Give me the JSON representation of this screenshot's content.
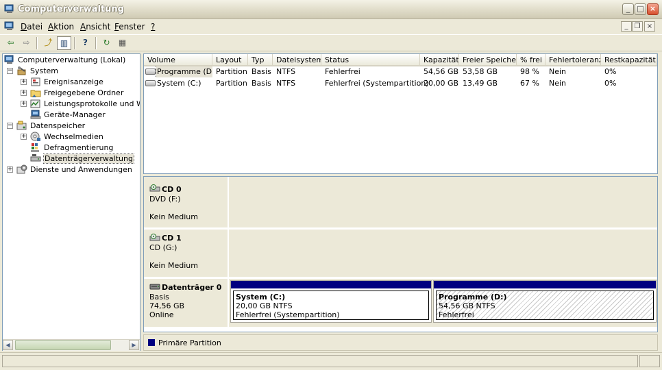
{
  "window": {
    "title": "Computerverwaltung",
    "controls": {
      "minimize": "_",
      "maximize": "□",
      "close": "×"
    }
  },
  "menu": [
    {
      "label": "Datei",
      "accel": "D",
      "rest": "atei"
    },
    {
      "label": "Aktion",
      "accel": "A",
      "rest": "ktion"
    },
    {
      "label": "Ansicht",
      "accel": "A",
      "rest": "nsicht"
    },
    {
      "label": "Fenster",
      "accel": "F",
      "rest": "enster"
    },
    {
      "label": "?",
      "accel": "?",
      "rest": ""
    }
  ],
  "mdi_controls": {
    "minimize": "_",
    "restore": "❐",
    "close": "×"
  },
  "toolbar": [
    {
      "icon": "back-arrow-icon",
      "glyph": "⇦"
    },
    {
      "icon": "forward-arrow-icon",
      "glyph": "⇨"
    },
    {
      "icon": "up-folder-icon",
      "glyph": "⤴"
    },
    {
      "icon": "show-hide-tree-icon",
      "glyph": "▥"
    },
    {
      "icon": "help-icon",
      "glyph": "?"
    },
    {
      "icon": "refresh-icon",
      "glyph": "↻"
    },
    {
      "icon": "properties-icon",
      "glyph": "▦"
    }
  ],
  "tree": {
    "root": "Computerverwaltung (Lokal)",
    "items": [
      {
        "label": "System",
        "expander": "−",
        "icon": "tools-icon"
      },
      {
        "label": "Ereignisanzeige",
        "expander": "+",
        "icon": "event-viewer-icon"
      },
      {
        "label": "Freigegebene Ordner",
        "expander": "+",
        "icon": "shared-folder-icon"
      },
      {
        "label": "Leistungsprotokolle und Warn",
        "expander": "+",
        "icon": "performance-icon"
      },
      {
        "label": "Geräte-Manager",
        "expander": "",
        "icon": "device-manager-icon"
      },
      {
        "label": "Datenspeicher",
        "expander": "−",
        "icon": "storage-icon"
      },
      {
        "label": "Wechselmedien",
        "expander": "+",
        "icon": "removable-media-icon"
      },
      {
        "label": "Defragmentierung",
        "expander": "",
        "icon": "defrag-icon"
      },
      {
        "label": "Datenträgerverwaltung",
        "expander": "",
        "icon": "disk-management-icon"
      },
      {
        "label": "Dienste und Anwendungen",
        "expander": "+",
        "icon": "services-icon"
      }
    ]
  },
  "volume_list": {
    "columns": [
      "Volume",
      "Layout",
      "Typ",
      "Dateisystem",
      "Status",
      "Kapazität",
      "Freier Speicher",
      "% frei",
      "Fehlertoleranz",
      "Restkapazität"
    ],
    "rows": [
      [
        "Programme (D:)",
        "Partition",
        "Basis",
        "NTFS",
        "Fehlerfrei",
        "54,56 GB",
        "53,58 GB",
        "98 %",
        "Nein",
        "0%"
      ],
      [
        "System (C:)",
        "Partition",
        "Basis",
        "NTFS",
        "Fehlerfrei (Systempartition)",
        "20,00 GB",
        "13,49 GB",
        "67 %",
        "Nein",
        "0%"
      ]
    ]
  },
  "disks": [
    {
      "name": "CD 0",
      "line1": "DVD (F:)",
      "line2": "",
      "line3": "Kein Medium"
    },
    {
      "name": "CD 1",
      "line1": "CD (G:)",
      "line2": "",
      "line3": "Kein Medium"
    },
    {
      "name": "Datenträger 0",
      "line1": "Basis",
      "line2": "74,56 GB",
      "line3": "Online"
    }
  ],
  "partitions": [
    {
      "title": "System  (C:)",
      "size": "20,00 GB NTFS",
      "status": "Fehlerfrei (Systempartition)"
    },
    {
      "title": "Programme  (D:)",
      "size": "54,56 GB NTFS",
      "status": "Fehlerfrei"
    }
  ],
  "legend": {
    "label": "Primäre Partition",
    "color": "#000080"
  },
  "scrollbar": {
    "left": "◀",
    "right": "▶"
  }
}
